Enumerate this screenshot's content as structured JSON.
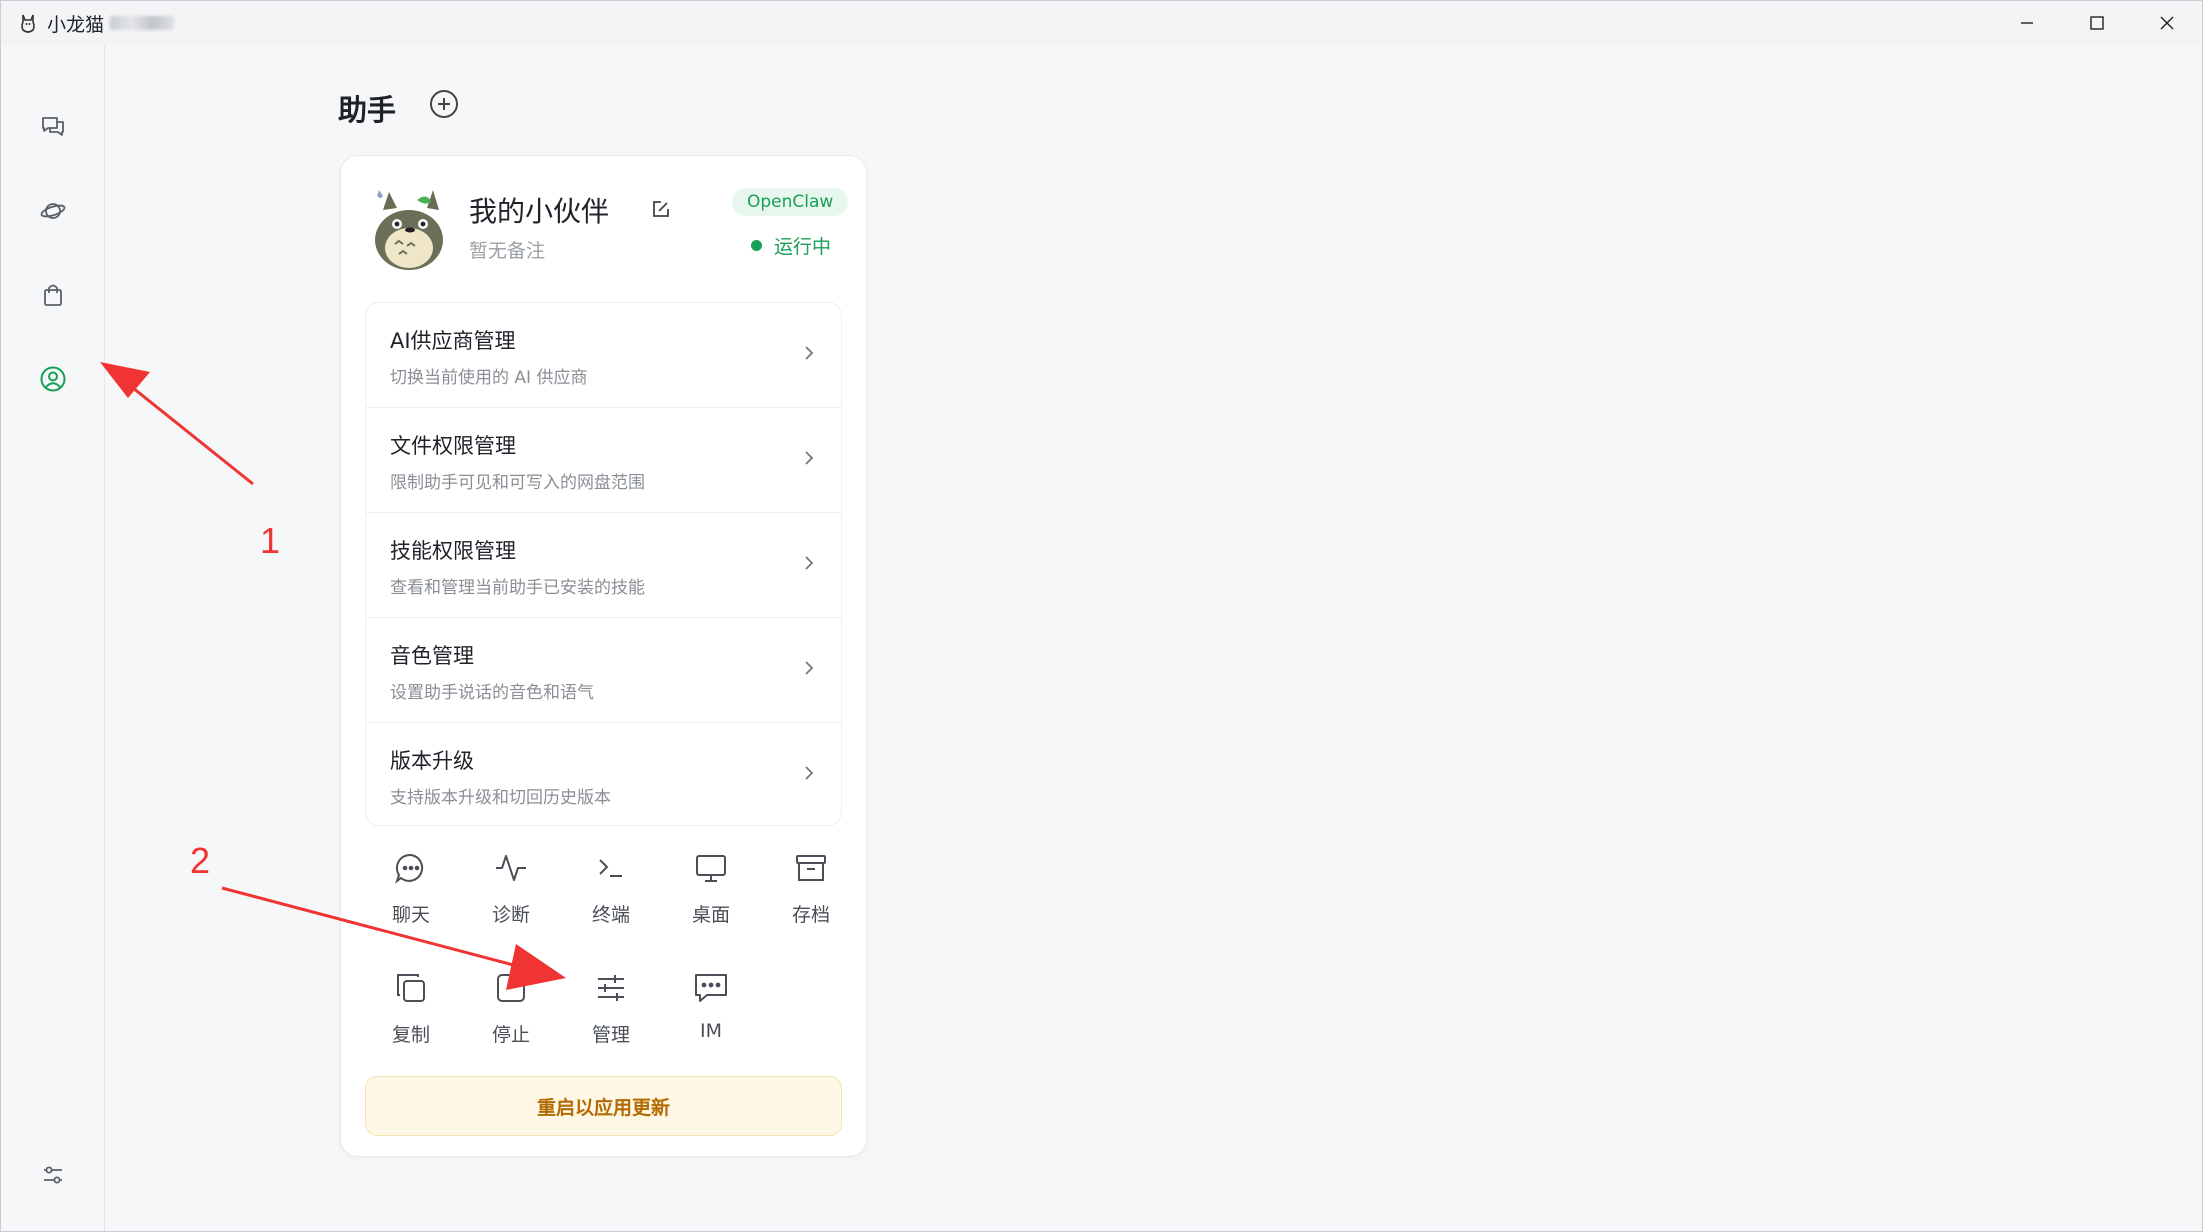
{
  "window": {
    "title": "小龙猫",
    "controls": [
      "minimize",
      "maximize",
      "close"
    ]
  },
  "rail": {
    "items": [
      {
        "icon": "chat-icon"
      },
      {
        "icon": "planet-icon"
      },
      {
        "icon": "bag-icon"
      },
      {
        "icon": "user-circle-icon",
        "active": true
      }
    ],
    "bottom": {
      "icon": "settings-sliders-icon"
    }
  },
  "page": {
    "title": "助手"
  },
  "assistant": {
    "name": "我的小伙伴",
    "remark": "暂无备注",
    "tag": "OpenClaw",
    "status": "运行中"
  },
  "menu": [
    {
      "title": "AI供应商管理",
      "desc": "切换当前使用的 AI 供应商"
    },
    {
      "title": "文件权限管理",
      "desc": "限制助手可见和可写入的网盘范围"
    },
    {
      "title": "技能权限管理",
      "desc": "查看和管理当前助手已安装的技能"
    },
    {
      "title": "音色管理",
      "desc": "设置助手说话的音色和语气"
    },
    {
      "title": "版本升级",
      "desc": "支持版本升级和切回历史版本"
    }
  ],
  "actions": [
    {
      "label": "聊天",
      "icon": "message-circle-icon"
    },
    {
      "label": "诊断",
      "icon": "activity-icon"
    },
    {
      "label": "终端",
      "icon": "terminal-icon"
    },
    {
      "label": "桌面",
      "icon": "monitor-icon"
    },
    {
      "label": "存档",
      "icon": "archive-icon"
    },
    {
      "label": "复制",
      "icon": "copy-icon"
    },
    {
      "label": "停止",
      "icon": "stop-icon"
    },
    {
      "label": "管理",
      "icon": "sliders-icon"
    },
    {
      "label": "IM",
      "icon": "message-dots-icon"
    }
  ],
  "restart_label": "重启以应用更新",
  "annotations": {
    "one": "1",
    "two": "2"
  },
  "colors": {
    "accent": "#18a058",
    "annotation": "#f03333",
    "warn_bg": "#fef7e6",
    "warn_text": "#b26b00"
  }
}
